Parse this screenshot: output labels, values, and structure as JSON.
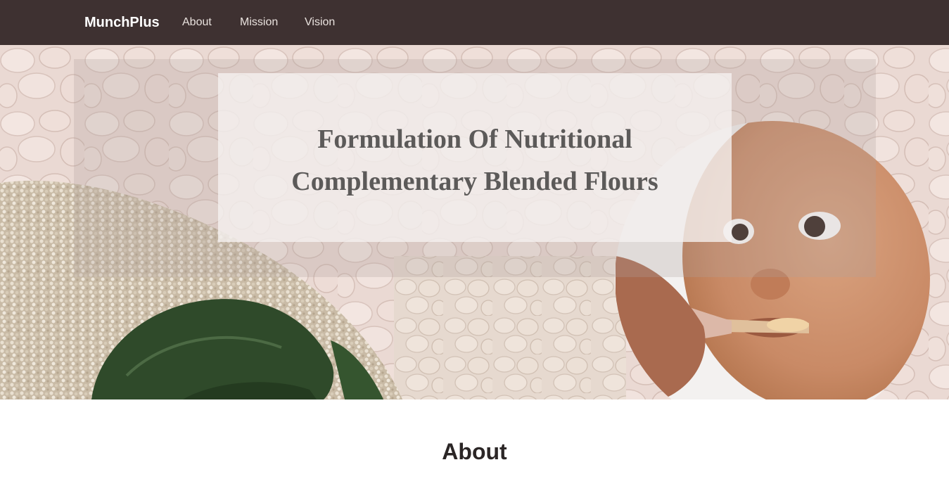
{
  "navbar": {
    "brand": "MunchPlus",
    "links": [
      {
        "label": "About"
      },
      {
        "label": "Mission"
      },
      {
        "label": "Vision"
      }
    ]
  },
  "hero": {
    "title_line1": "Formulation Of Nutritional",
    "title_line2": "Complementary Blended Flours"
  },
  "about": {
    "heading": "About"
  },
  "colors": {
    "navbar_bg": "#3e3131",
    "nav_text": "#e9e2de",
    "hero_title": "#5c5a59",
    "heading_text": "#2b2626"
  }
}
